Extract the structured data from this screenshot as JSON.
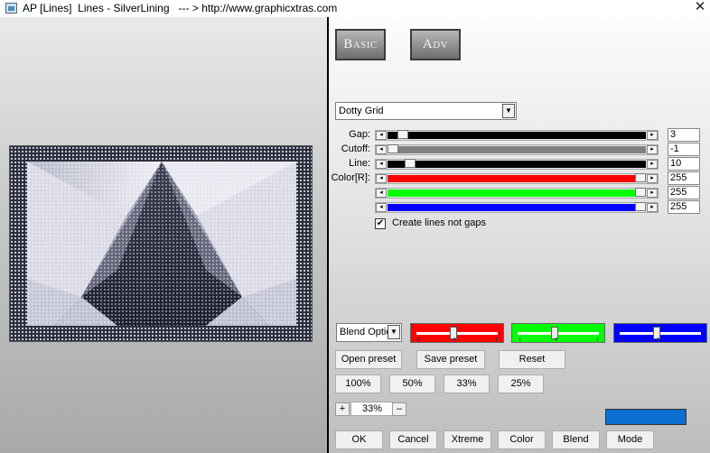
{
  "window": {
    "title": "AP [Lines]  Lines - SilverLining   --- > http://www.graphicxtras.com",
    "close_glyph": "✕",
    "app_icon": "app-window-icon"
  },
  "tabs": [
    {
      "label": "Basic"
    },
    {
      "label": "Adv"
    }
  ],
  "pattern": {
    "selected": "Dotty Grid"
  },
  "sliders": [
    {
      "label": "Gap:",
      "value": "3",
      "fraction": 0.04,
      "fill": "#000000"
    },
    {
      "label": "Cutoff:",
      "value": "-1",
      "fraction": 0.0,
      "fill": "#808080"
    },
    {
      "label": "Line:",
      "value": "10",
      "fraction": 0.07,
      "fill": "#000000"
    },
    {
      "label": "Color[R]:",
      "value": "255",
      "fraction": 1.0,
      "fill": "#ff0000"
    },
    {
      "label": "",
      "value": "255",
      "fraction": 1.0,
      "fill": "#00ff00"
    },
    {
      "label": "",
      "value": "255",
      "fraction": 1.0,
      "fill": "#0000ff"
    }
  ],
  "checkbox": {
    "label": "Create lines not gaps",
    "checked": true,
    "mark": "✔"
  },
  "blend": {
    "selected": "Blend Optio",
    "channels": [
      {
        "color": "#ff0000",
        "fraction": 0.45
      },
      {
        "color": "#00ff00",
        "fraction": 0.45
      },
      {
        "color": "#0000ff",
        "fraction": 0.45
      }
    ]
  },
  "buttons": {
    "open_preset": "Open preset",
    "save_preset": "Save preset",
    "reset": "Reset",
    "zoom_100": "100%",
    "zoom_50": "50%",
    "zoom_33": "33%",
    "zoom_25": "25%",
    "zoom_in": "+",
    "zoom_out": "–",
    "ok": "OK",
    "cancel": "Cancel",
    "xtreme": "Xtreme",
    "color": "Color",
    "blend": "Blend",
    "mode": "Mode"
  },
  "zoom": {
    "value": "33%"
  },
  "current_color": "#0a6fd0",
  "glyphs": {
    "left": "◂",
    "right": "▸",
    "down": "▼"
  }
}
